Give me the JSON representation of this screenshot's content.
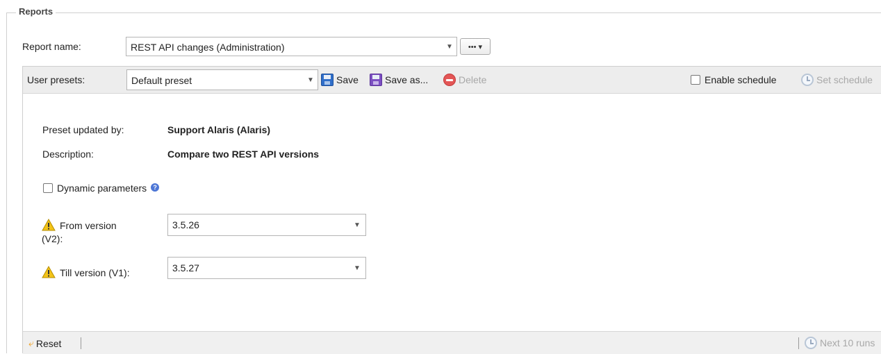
{
  "fieldset": {
    "legend": "Reports"
  },
  "report": {
    "label": "Report name:",
    "value": "REST API changes (Administration)",
    "more_button": "••• ▾"
  },
  "toolbar": {
    "presets_label": "User presets:",
    "preset_value": "Default preset",
    "save": "Save",
    "save_as": "Save as...",
    "delete": "Delete",
    "enable_schedule": "Enable schedule",
    "set_schedule": "Set schedule"
  },
  "info": {
    "updated_by_label": "Preset updated by:",
    "updated_by_value": "Support Alaris (Alaris)",
    "description_label": "Description:",
    "description_value": "Compare two REST API versions"
  },
  "dynamic_parameters": {
    "label": "Dynamic parameters",
    "help": "?"
  },
  "params": {
    "from": {
      "label_line1": "From version",
      "label_line2": "(V2):",
      "value": "3.5.26"
    },
    "till": {
      "label": "Till version (V1):",
      "value": "3.5.27"
    }
  },
  "footer": {
    "reset": "Reset",
    "next_runs": "Next 10 runs"
  },
  "icons": {
    "dropdown": "chevron-down-icon",
    "save": "floppy-disk-icon",
    "delete": "delete-icon",
    "schedule": "clock-icon",
    "warning": "warning-icon",
    "reset": "undo-arrow-icon"
  },
  "colors": {
    "toolbar_bg": "#ededed",
    "warning": "#f2c318",
    "help": "#4e77d6",
    "delete": "#e35656"
  }
}
